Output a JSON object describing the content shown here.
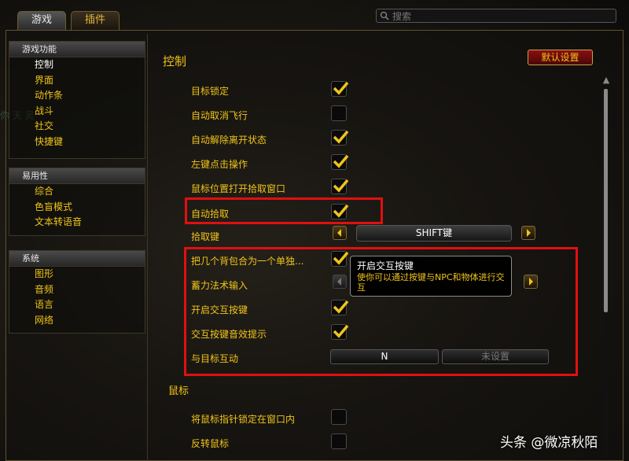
{
  "tabs": {
    "game": "游戏",
    "addons": "插件"
  },
  "search": {
    "placeholder": "搜索"
  },
  "sidebar": {
    "sections": [
      {
        "title": "游戏功能",
        "items": [
          "控制",
          "界面",
          "动作条",
          "战斗",
          "社交",
          "快捷键"
        ]
      },
      {
        "title": "易用性",
        "items": [
          "综合",
          "色盲模式",
          "文本转语音"
        ]
      },
      {
        "title": "系统",
        "items": [
          "图形",
          "音频",
          "语言",
          "网络"
        ]
      }
    ],
    "selected": "控制"
  },
  "panel": {
    "title": "控制",
    "default_button": "默认设置",
    "rows": [
      {
        "label": "目标锁定",
        "checked": true
      },
      {
        "label": "自动取消飞行",
        "checked": false
      },
      {
        "label": "自动解除离开状态",
        "checked": true
      },
      {
        "label": "左键点击操作",
        "checked": true
      },
      {
        "label": "鼠标位置打开拾取窗口",
        "checked": true
      },
      {
        "label": "自动拾取",
        "checked": true
      }
    ],
    "loot_key": {
      "label": "拾取键",
      "value": "SHIFT键"
    },
    "rows2": [
      {
        "label": "把几个背包合为一个单独...",
        "checked": true
      },
      {
        "label": "蓄力法术输入"
      },
      {
        "label": "开启交互按键",
        "checked": true
      },
      {
        "label": "交互按键音效提示",
        "checked": true
      }
    ],
    "interact_target": {
      "label": "与目标互动",
      "key1": "N",
      "key2": "未设置"
    },
    "tooltip": {
      "title": "开启交互按键",
      "desc": "使你可以通过按键与NPC和物体进行交互"
    },
    "mouse_section": "鼠标",
    "mouse_rows": [
      {
        "label": "将鼠标指针锁定在窗口内",
        "checked": false
      },
      {
        "label": "反转鼠标",
        "checked": false
      }
    ]
  },
  "background_text": "你 天 灵",
  "watermark": "头条 @微凉秋陌",
  "colors": {
    "accent": "#f0c419",
    "highlight": "#e01010",
    "button_red": "#8b1010"
  }
}
